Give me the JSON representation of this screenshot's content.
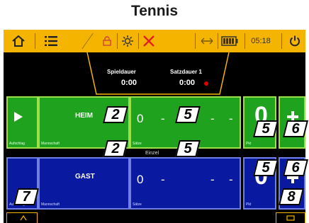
{
  "page_title": "Tennis",
  "toolbar": {
    "home_icon": "home-icon",
    "menu_icon": "menu-icon",
    "lock_icon": "lock-icon",
    "brightness_icon": "brightness-icon",
    "close_icon": "close-icon",
    "swap_icon": "swap-sides-icon",
    "battery_icon": "battery-icon",
    "time": "05:18",
    "power_icon": "power-icon"
  },
  "timers": {
    "game_label": "Spieldauer",
    "game_value": "0:00",
    "set_label": "Satzdauer 1",
    "set_value": "0:00",
    "set_indicator_color": "#e00000"
  },
  "home": {
    "serve_label": "Aufschlag",
    "team_caption": "Mannschaft",
    "name": "HEIM",
    "sets_left": "0",
    "sets_dash": "-",
    "sets_caption": "Sätze",
    "sets_trailing_dash": "-",
    "trailing_dash": "-",
    "points": "0",
    "points_caption": "Pkt",
    "color": "#1fa31f"
  },
  "mode_label": "Einzel",
  "guest": {
    "serve_label": "Aufschlag",
    "team_caption": "Mannschaft",
    "name": "GAST",
    "sets_left": "0",
    "sets_dash": "-",
    "sets_caption": "Sätze",
    "sets_trailing_dash": "-",
    "trailing_dash": "-",
    "points": "0",
    "points_caption": "Pkt",
    "color": "#0a1aa0"
  },
  "callouts": {
    "home_name": "2",
    "home_sets": "5",
    "home_points": "5",
    "home_plus": "6",
    "guest_name": "2",
    "guest_sets": "5",
    "guest_points": "5",
    "guest_plus": "6",
    "bottom_left": "7",
    "bottom_right": "8"
  }
}
